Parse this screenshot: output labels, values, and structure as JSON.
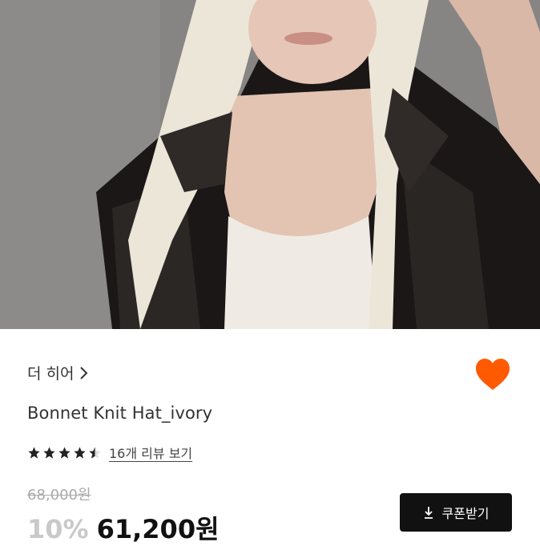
{
  "product": {
    "brand": "더 히어",
    "name": "Bonnet Knit Hat_ivory",
    "rating_stars": 4.5,
    "review_link": "16개 리뷰 보기",
    "original_price": "68,000원",
    "discount": "10%",
    "sale_price": "61,200원",
    "liked": true
  },
  "actions": {
    "coupon_label": "쿠폰받기"
  },
  "icons": {
    "brand_arrow": "chevron-right-icon",
    "wishlist": "heart-icon",
    "coupon": "download-icon",
    "star": "star-icon"
  },
  "colors": {
    "heart": "#ff5a00",
    "button_bg": "#111111",
    "discount": "#c9c9c9",
    "original_price": "#aaaaaa"
  }
}
